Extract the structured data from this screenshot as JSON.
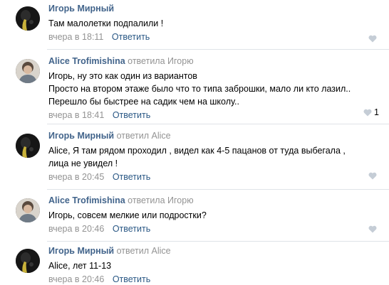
{
  "comments": [
    {
      "author": "Игорь Мирный",
      "reply_to": "",
      "lines": [
        "Там малолетки подпалили !"
      ],
      "date": "вчера в 18:11",
      "reply_label": "Ответить",
      "likes": ""
    },
    {
      "author": "Alice Trofimishina",
      "reply_to": "ответила Игорю",
      "lines": [
        "Игорь, ну это как один из вариантов",
        "Просто на втором этаже было что то типа заброшки, мало ли кто лазил..",
        "Перешло бы быстрее на садик чем на школу.."
      ],
      "date": "вчера в 18:41",
      "reply_label": "Ответить",
      "likes": "1"
    },
    {
      "author": "Игорь Мирный",
      "reply_to": "ответил Alice",
      "lines": [
        "Alice, Я там рядом проходил , видел как 4-5 пацанов от туда выбегала ,",
        "лица не увидел !"
      ],
      "date": "вчера в 20:45",
      "reply_label": "Ответить",
      "likes": ""
    },
    {
      "author": "Alice Trofimishina",
      "reply_to": "ответила Игорю",
      "lines": [
        "Игорь, совсем мелкие или подростки?"
      ],
      "date": "вчера в 20:46",
      "reply_label": "Ответить",
      "likes": ""
    },
    {
      "author": "Игорь Мирный",
      "reply_to": "ответил Alice",
      "lines": [
        "Alice, лет 11-13"
      ],
      "date": "вчера в 20:46",
      "reply_label": "Ответить",
      "likes": ""
    }
  ],
  "colors": {
    "author": "#42648b",
    "muted": "#939393",
    "link": "#2a5885",
    "separator": "#dfe3e8",
    "like_icon": "#c5cdd6"
  },
  "icons": {
    "like": "heart-icon"
  }
}
